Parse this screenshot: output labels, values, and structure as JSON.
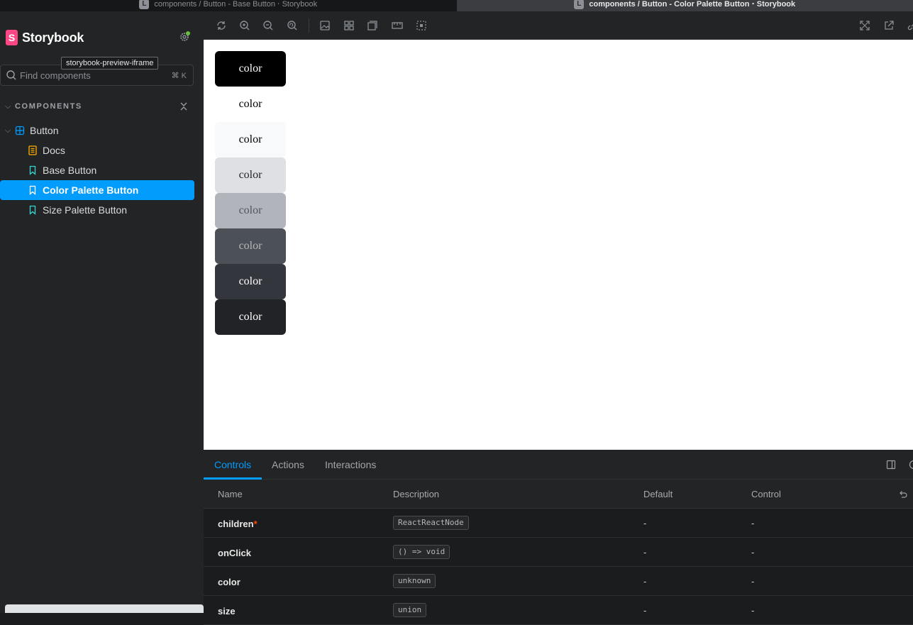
{
  "browser_tabs": [
    {
      "favicon": "L",
      "title": "components / Button - Base Button ⋅ Storybook"
    },
    {
      "favicon": "L",
      "title": "components / Button - Color Palette Button ⋅ Storybook"
    }
  ],
  "sidebar": {
    "brand": {
      "logo": "S",
      "name": "Storybook"
    },
    "tooltip": "storybook-preview-iframe",
    "search": {
      "placeholder": "Find components",
      "shortcut": "⌘ K"
    },
    "section_title": "COMPONENTS",
    "tree": [
      {
        "label": "Button",
        "icon": "component-icon",
        "kind": "component"
      },
      {
        "label": "Docs",
        "icon": "docs-icon",
        "kind": "docs"
      },
      {
        "label": "Base Button",
        "icon": "bookmark-icon",
        "kind": "story"
      },
      {
        "label": "Color Palette Button",
        "icon": "bookmark-icon",
        "kind": "story",
        "selected": true
      },
      {
        "label": "Size Palette Button",
        "icon": "bookmark-icon",
        "kind": "story"
      }
    ]
  },
  "preview": {
    "buttons": [
      {
        "label": "color",
        "bg": "#000000",
        "fg": "#ffffff"
      },
      {
        "label": "color",
        "bg": "#ffffff",
        "fg": "#000000"
      },
      {
        "label": "color",
        "bg": "#f8f9fa",
        "fg": "#000000"
      },
      {
        "label": "color",
        "bg": "#dee0e4",
        "fg": "#1f2328"
      },
      {
        "label": "color",
        "bg": "#b1b5bb",
        "fg": "#50555c"
      },
      {
        "label": "color",
        "bg": "#4c5157",
        "fg": "#b4b8bd"
      },
      {
        "label": "color",
        "bg": "#33363c",
        "fg": "#ffffff"
      },
      {
        "label": "color",
        "bg": "#212327",
        "fg": "#ffffff"
      }
    ]
  },
  "addons": {
    "tabs": [
      "Controls",
      "Actions",
      "Interactions"
    ],
    "active_tab": "Controls",
    "columns": [
      "Name",
      "Description",
      "Default",
      "Control"
    ],
    "rows": [
      {
        "name": "children",
        "required": "*",
        "type": "ReactReactNode",
        "default": "-",
        "control": "-"
      },
      {
        "name": "onClick",
        "required": "",
        "type": "() => void",
        "default": "-",
        "control": "-"
      },
      {
        "name": "color",
        "required": "",
        "type": "unknown",
        "default": "-",
        "control": "-"
      },
      {
        "name": "size",
        "required": "",
        "type": "union",
        "default": "-",
        "control": "-"
      }
    ]
  },
  "colors": {
    "accent": "#029cfd",
    "brand": "#ff4785",
    "required": "#ff4400"
  }
}
